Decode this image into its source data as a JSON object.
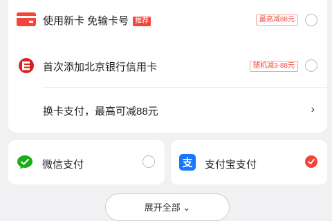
{
  "cards": [
    {
      "label": "使用新卡 免输卡号",
      "tag": "推荐",
      "promo": "最高减88元",
      "icon": "red-card-icon"
    },
    {
      "label": "首次添加北京银行信用卡",
      "promo": "随机减3-88元",
      "icon": "bank-of-beijing-logo"
    }
  ],
  "switch_card": {
    "label": "换卡支付，最高可减88元",
    "chevron": "›"
  },
  "payments": [
    {
      "label": "微信支付",
      "icon": "wechat-pay-icon",
      "selected": false
    },
    {
      "label": "支付宝支付",
      "icon": "alipay-icon",
      "selected": true
    }
  ],
  "expand_all": {
    "label": "展开全部 ⌄"
  },
  "colors": {
    "accent": "#f0453b",
    "wechat": "#1aad19",
    "alipay": "#1677ff",
    "background": "#f1f1f4"
  }
}
